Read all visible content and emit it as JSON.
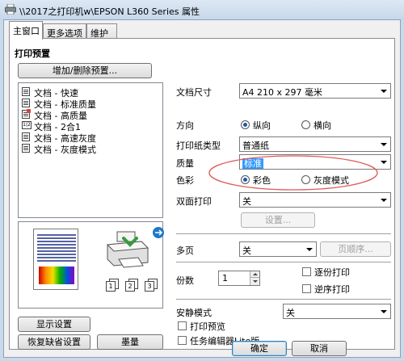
{
  "window": {
    "title": "\\\\2017之打印机w\\EPSON L360 Series 属性"
  },
  "tabs": [
    {
      "label": "主窗口"
    },
    {
      "label": "更多选项"
    },
    {
      "label": "维护"
    }
  ],
  "left": {
    "section_title": "打印预置",
    "add_remove_button": "增加/删除预置...",
    "presets": [
      {
        "label": "文档 - 快速"
      },
      {
        "label": "文档 - 标准质量"
      },
      {
        "label": "文档 - 高质量"
      },
      {
        "label": "文档 - 2合1"
      },
      {
        "label": "文档 - 高速灰度"
      },
      {
        "label": "文档 - 灰度模式"
      }
    ],
    "page_badges": [
      "1",
      "2",
      "3"
    ],
    "show_settings_button": "显示设置",
    "restore_defaults_button": "恢复缺省设置",
    "ink_levels_button": "墨量"
  },
  "right": {
    "doc_size_label": "文档尺寸",
    "doc_size_value": "A4 210 x 297 毫米",
    "orientation_label": "方向",
    "portrait_label": "纵向",
    "landscape_label": "横向",
    "paper_type_label": "打印纸类型",
    "paper_type_value": "普通纸",
    "quality_label": "质量",
    "quality_value": "标准",
    "color_label": "色彩",
    "color_option": "彩色",
    "grayscale_option": "灰度模式",
    "duplex_label": "双面打印",
    "duplex_value": "关",
    "duplex_settings_button": "设置...",
    "multipage_label": "多页",
    "multipage_value": "关",
    "page_order_button": "页顺序...",
    "copies_label": "份数",
    "copies_value": "1",
    "collate_label": "逐份打印",
    "reverse_label": "逆序打印",
    "quiet_mode_label": "安静模式",
    "quiet_mode_value": "关",
    "print_preview_label": "打印预览",
    "job_arranger_label": "任务编辑器Lite版"
  },
  "footer": {
    "ok_button": "确定",
    "cancel_button": "取消"
  },
  "colors": {
    "accent": "#3399ff",
    "annotation": "#e05a5a",
    "printer_arrow": "#3a9a3a",
    "help_icon": "#1f78c8"
  }
}
